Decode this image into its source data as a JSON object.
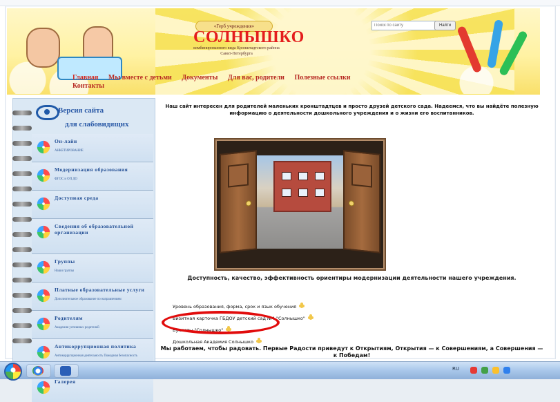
{
  "header": {
    "tag": "«Герб учреждения»",
    "title": "СОЛНЫШКО",
    "subtitle": "комбинированного вида Кронштадтского района Санкт-Петербурга",
    "search_placeholder": "Поиск по сайту",
    "search_button": "Найти"
  },
  "nav": [
    {
      "label": "Главная"
    },
    {
      "label": "Мы вместе с детьми"
    },
    {
      "label": "Документы"
    },
    {
      "label": "Для вас, родители"
    },
    {
      "label": "Полезные ссылки"
    },
    {
      "label": "Контакты"
    }
  ],
  "left": {
    "vision_title_line1": "Версия сайта",
    "vision_title_line2": "для слабовидящих",
    "menu": [
      {
        "title": "Он-лайн",
        "sub": "АНКЕТИРОВАНИЕ"
      },
      {
        "title": "Модернизация образования",
        "sub": "ФГОС и ОП ДО"
      },
      {
        "title": "Доступная среда",
        "sub": ""
      },
      {
        "title": "Сведения об образовательной организации",
        "sub": ""
      },
      {
        "title": "Группы",
        "sub": "Наши группы"
      },
      {
        "title": "Платные образовательные услуги",
        "sub": "Дополнительное образование по направлениям"
      },
      {
        "title": "Родителям",
        "sub": "Академия успешных родителей"
      },
      {
        "title": "Антикоррупционная политика",
        "sub": "Антикоррупционная деятельность Пожарная безопасность"
      },
      {
        "title": "Галерея",
        "sub": ""
      }
    ]
  },
  "main": {
    "intro": "Наш сайт интересен для родителей маленьких кронштадтцев и просто друзей детского сада. Надеемся, что вы найдёте полезную информацию о деятельности дошкольного учреждения и о жизни его воспитанников.",
    "headline": "Доступность, качество, эффективность ориентиры модернизации деятельности нашего учреждения.",
    "links": [
      "Уровень образования, форма, срок и язык обучения",
      "Визитная карточка ГБДОУ детский сад №4 \"Солнышко\"",
      "Буклеты \"Солнышко\"",
      "Дошкольная Академия Солнышко"
    ],
    "footer": "Мы работаем, чтобы радовать. Первые Радости приведут к Открытиям, Открытия — к Совершениям, а Совершения — к Победам!"
  },
  "taskbar": {
    "lang": "RU"
  },
  "colors": {
    "accent_red": "#e10c0c",
    "nav_red": "#b72a23",
    "left_bg": "#dbe8f4"
  }
}
